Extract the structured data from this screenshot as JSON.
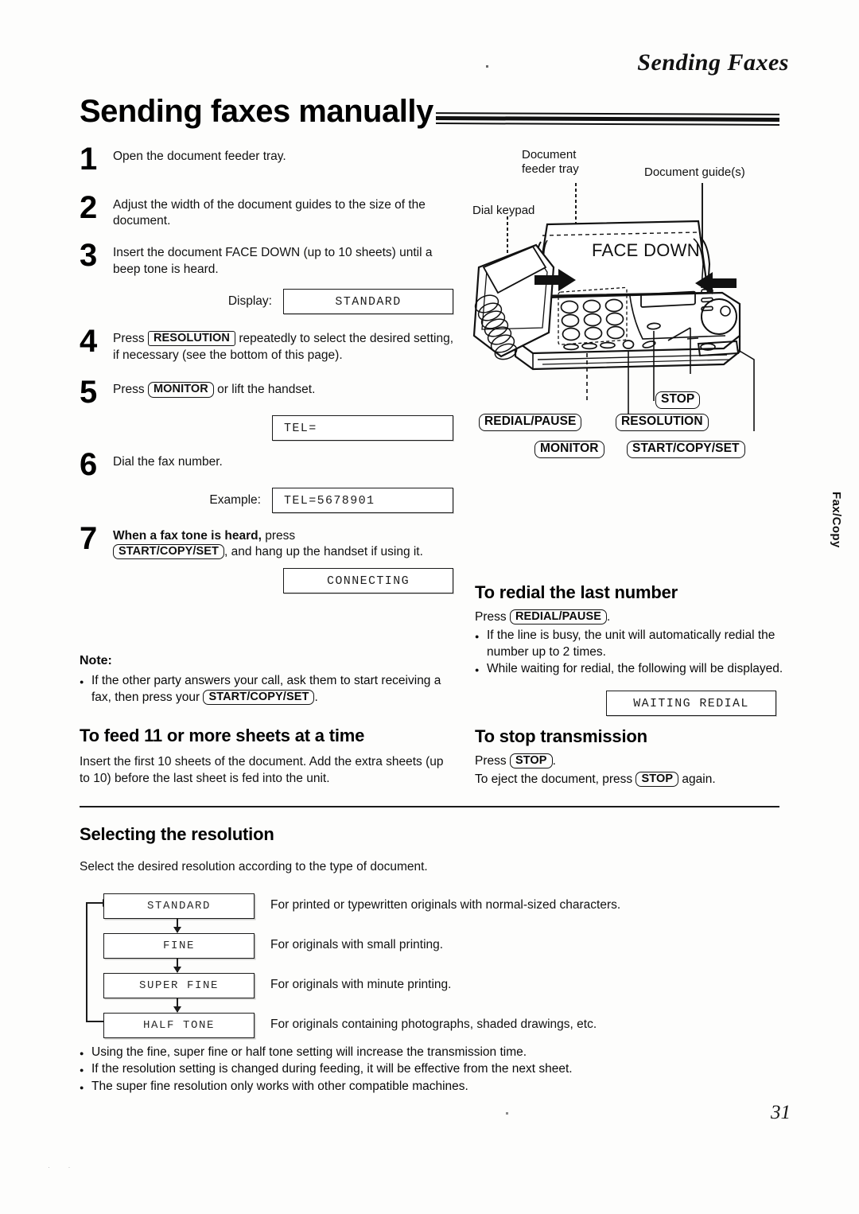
{
  "header": {
    "running_head": "Sending Faxes",
    "title": "Sending faxes manually"
  },
  "steps": [
    {
      "num": "1",
      "text": "Open the document feeder tray."
    },
    {
      "num": "2",
      "text": "Adjust the width of the document guides to the size of the document."
    },
    {
      "num": "3",
      "text": "Insert the document FACE DOWN (up to 10 sheets) until a beep tone is heard."
    },
    {
      "num": "4",
      "pre": "Press",
      "key": "RESOLUTION",
      "post": "repeatedly to select the desired setting, if necessary (see the bottom of this page)."
    },
    {
      "num": "5",
      "pre": "Press",
      "key": "MONITOR",
      "post": "or lift the handset."
    },
    {
      "num": "6",
      "text": "Dial the fax number."
    },
    {
      "num": "7",
      "bold": "When a fax tone is heard,",
      "pre": "press",
      "key": "START/COPY/SET",
      "post": ", and hang up the handset if using it."
    }
  ],
  "displays": {
    "display_label": "Display:",
    "standard": "STANDARD",
    "tel": "TEL=",
    "example_label": "Example:",
    "example_tel": "TEL=5678901",
    "connecting": "CONNECTING",
    "waiting_redial": "WAITING REDIAL"
  },
  "note": {
    "heading": "Note:",
    "pre": "If the other party answers your call, ask them to start receiving a fax, then press your",
    "key": "START/COPY/SET",
    "post": "."
  },
  "feed_section": {
    "heading": "To feed 11 or more sheets at a time",
    "body": "Insert the first 10 sheets of the document. Add the extra sheets (up to 10) before the last sheet is fed into the unit."
  },
  "redial_section": {
    "heading": "To redial the last number",
    "press_pre": "Press",
    "press_key": "REDIAL/PAUSE",
    "press_post": ".",
    "bullets": [
      "If the line is busy, the unit will automatically redial the number up to 2 times.",
      "While waiting for redial, the following will be displayed."
    ]
  },
  "stop_section": {
    "heading": "To stop transmission",
    "press_pre": "Press",
    "press_key": "STOP",
    "press_post": ".",
    "eject_pre": "To eject the document, press",
    "eject_key": "STOP",
    "eject_post": "again."
  },
  "resolution_section": {
    "heading": "Selecting the resolution",
    "intro": "Select the desired resolution according to the type of document.",
    "rows": [
      {
        "mode": "STANDARD",
        "desc": "For printed or typewritten originals with normal-sized characters."
      },
      {
        "mode": "FINE",
        "desc": "For originals with small printing."
      },
      {
        "mode": "SUPER FINE",
        "desc": "For originals with minute printing."
      },
      {
        "mode": "HALF TONE",
        "desc": "For originals containing photographs, shaded drawings, etc."
      }
    ],
    "bullets": [
      "Using the fine, super fine or half tone setting will increase the transmission time.",
      "If the resolution setting is changed during feeding, it will be effective from the next sheet.",
      "The super fine resolution only works with other compatible machines."
    ]
  },
  "illustration": {
    "callouts": {
      "document_feeder_tray_line1": "Document",
      "document_feeder_tray_line2": "feeder tray",
      "document_guides": "Document guide(s)",
      "dial_keypad": "Dial keypad",
      "face_down": "FACE DOWN"
    },
    "button_tags": {
      "stop": "STOP",
      "redial_pause": "REDIAL/PAUSE",
      "resolution": "RESOLUTION",
      "monitor": "MONITOR",
      "start_copy_set": "START/COPY/SET"
    }
  },
  "side_tab": "Fax/Copy",
  "page_number": "31"
}
